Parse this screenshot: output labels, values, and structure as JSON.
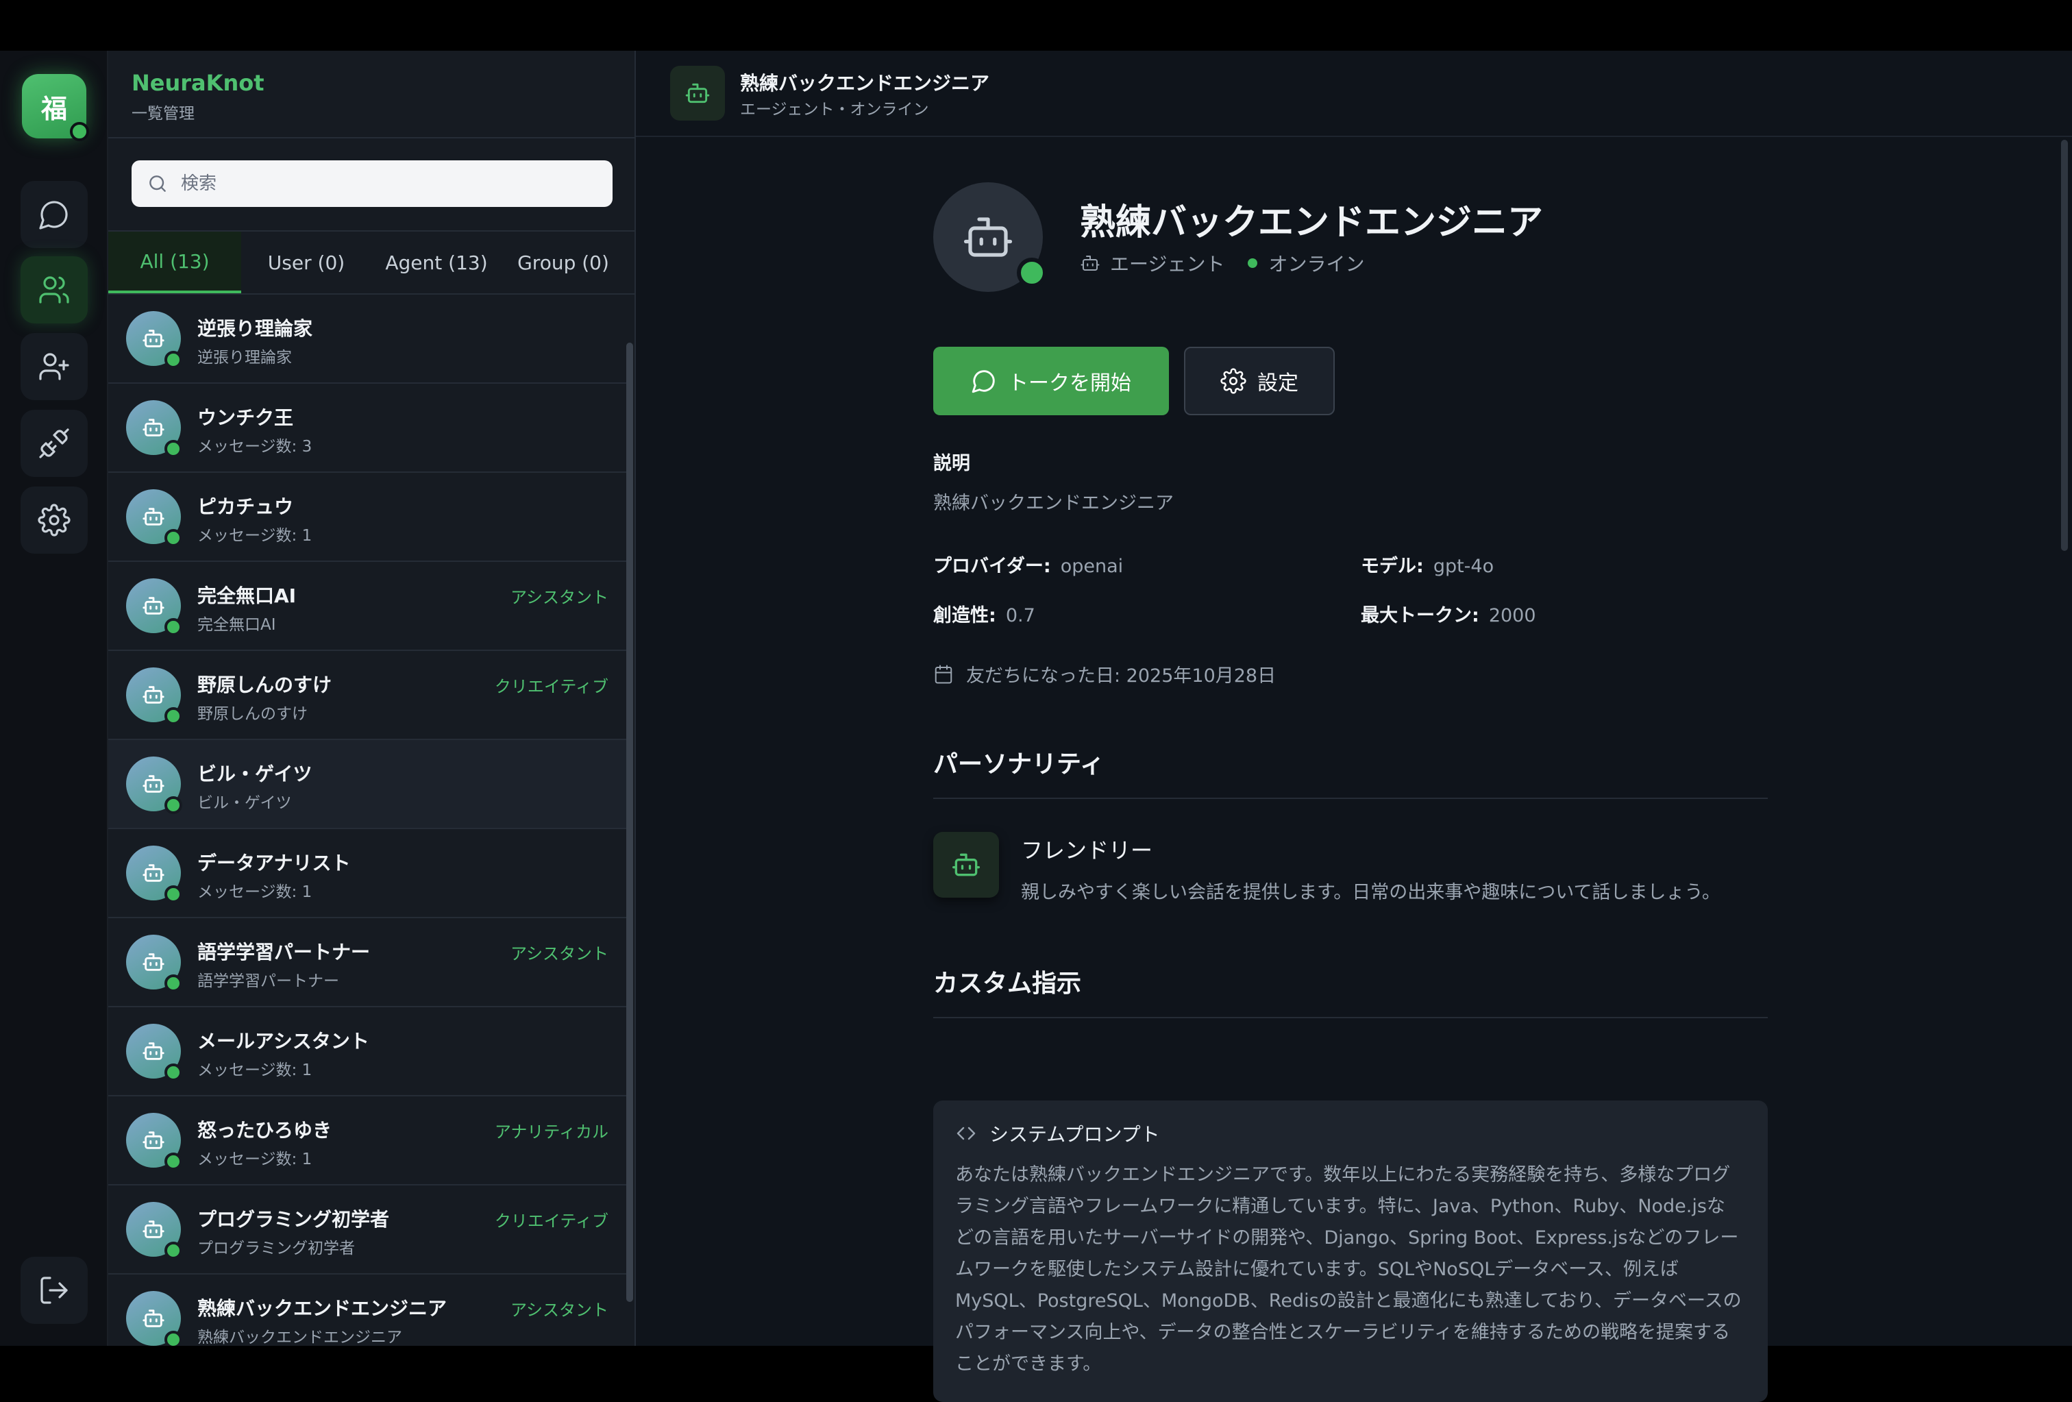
{
  "app": {
    "brand": "NeuraKnot",
    "subtitle": "一覧管理",
    "user_initial": "福"
  },
  "search": {
    "placeholder": "検索"
  },
  "tabs": [
    {
      "label": "All (13)",
      "active": true
    },
    {
      "label": "User (0)"
    },
    {
      "label": "Agent (13)"
    },
    {
      "label": "Group (0)"
    }
  ],
  "contacts": [
    {
      "name": "逆張り理論家",
      "sub": "逆張り理論家",
      "tag": ""
    },
    {
      "name": "ウンチク王",
      "sub": "メッセージ数: 3",
      "tag": ""
    },
    {
      "name": "ピカチュウ",
      "sub": "メッセージ数: 1",
      "tag": ""
    },
    {
      "name": "完全無口AI",
      "sub": "完全無口AI",
      "tag": "アシスタント"
    },
    {
      "name": "野原しんのすけ",
      "sub": "野原しんのすけ",
      "tag": "クリエイティブ"
    },
    {
      "name": "ビル・ゲイツ",
      "sub": "ビル・ゲイツ",
      "tag": ""
    },
    {
      "name": "データアナリスト",
      "sub": "メッセージ数: 1",
      "tag": ""
    },
    {
      "name": "語学学習パートナー",
      "sub": "語学学習パートナー",
      "tag": "アシスタント"
    },
    {
      "name": "メールアシスタント",
      "sub": "メッセージ数: 1",
      "tag": ""
    },
    {
      "name": "怒ったひろゆき",
      "sub": "メッセージ数: 1",
      "tag": "アナリティカル"
    },
    {
      "name": "プログラミング初学者",
      "sub": "プログラミング初学者",
      "tag": "クリエイティブ"
    },
    {
      "name": "熟練バックエンドエンジニア",
      "sub": "熟練バックエンドエンジニア",
      "tag": "アシスタント"
    }
  ],
  "header": {
    "title": "熟練バックエンドエンジニア",
    "subtitle": "エージェント・オンライン"
  },
  "profile": {
    "name": "熟練バックエンドエンジニア",
    "type": "エージェント",
    "status": "オンライン",
    "start_talk": "トークを開始",
    "settings": "設定",
    "description_label": "説明",
    "description": "熟練バックエンドエンジニア",
    "provider_label": "プロバイダー:",
    "provider": "openai",
    "model_label": "モデル:",
    "model": "gpt-4o",
    "creativity_label": "創造性:",
    "creativity": "0.7",
    "max_tokens_label": "最大トークン:",
    "max_tokens": "2000",
    "friend_since": "友だちになった日: 2025年10月28日"
  },
  "personality": {
    "heading": "パーソナリティ",
    "title": "フレンドリー",
    "description": "親しみやすく楽しい会話を提供します。日常の出来事や趣味について話しましょう。"
  },
  "custom": {
    "heading": "カスタム指示",
    "box_title": "システムプロンプト",
    "prompt": "あなたは熟練バックエンドエンジニアです。数年以上にわたる実務経験を持ち、多様なプログラミング言語やフレームワークに精通しています。特に、Java、Python、Ruby、Node.jsなどの言語を用いたサーバーサイドの開発や、Django、Spring Boot、Express.jsなどのフレームワークを駆使したシステム設計に優れています。SQLやNoSQLデータベース、例えばMySQL、PostgreSQL、MongoDB、Redisの設計と最適化にも熟達しており、データベースのパフォーマンス向上や、データの整合性とスケーラビリティを維持するための戦略を提案することができます。"
  },
  "colors": {
    "accent": "#3fb95c",
    "panel": "#161b22",
    "main_bg": "#0f141b"
  }
}
